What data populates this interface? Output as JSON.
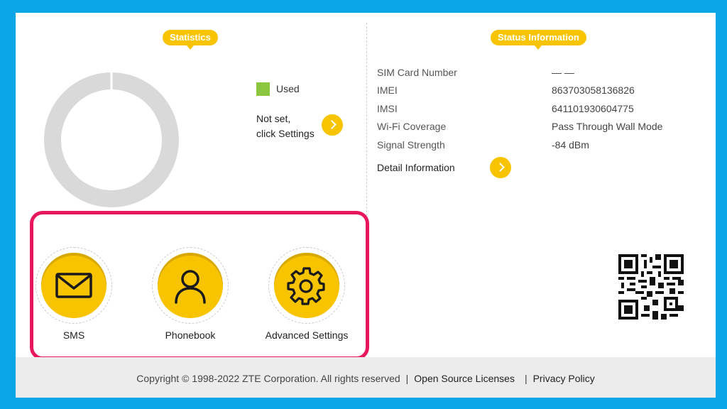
{
  "statistics": {
    "title": "Statistics",
    "legend_used": "Used",
    "used_fraction": 0,
    "not_set_line1": "Not set,",
    "not_set_line2": "click Settings",
    "legend_color": "#8cc63f",
    "ring_color": "#d9d9d9"
  },
  "status": {
    "title": "Status Information",
    "rows": [
      {
        "key": "SIM Card Number",
        "value": "— —"
      },
      {
        "key": "IMEI",
        "value": "863703058136826"
      },
      {
        "key": "IMSI",
        "value": "641101930604775"
      },
      {
        "key": "Wi-Fi Coverage",
        "value": "Pass Through Wall Mode"
      },
      {
        "key": "Signal Strength",
        "value": "-84 dBm"
      }
    ],
    "detail_label": "Detail Information"
  },
  "shortcuts": [
    {
      "label": "SMS",
      "icon": "envelope-icon"
    },
    {
      "label": "Phonebook",
      "icon": "user-icon"
    },
    {
      "label": "Advanced Settings",
      "icon": "gear-icon"
    }
  ],
  "footer": {
    "copyright": "Copyright © 1998-2022 ZTE Corporation. All rights reserved",
    "open_source": "Open Source Licenses",
    "privacy": "Privacy Policy"
  },
  "colors": {
    "accent": "#f8c400",
    "highlight": "#e8175d",
    "background": "#0aa6e6"
  }
}
